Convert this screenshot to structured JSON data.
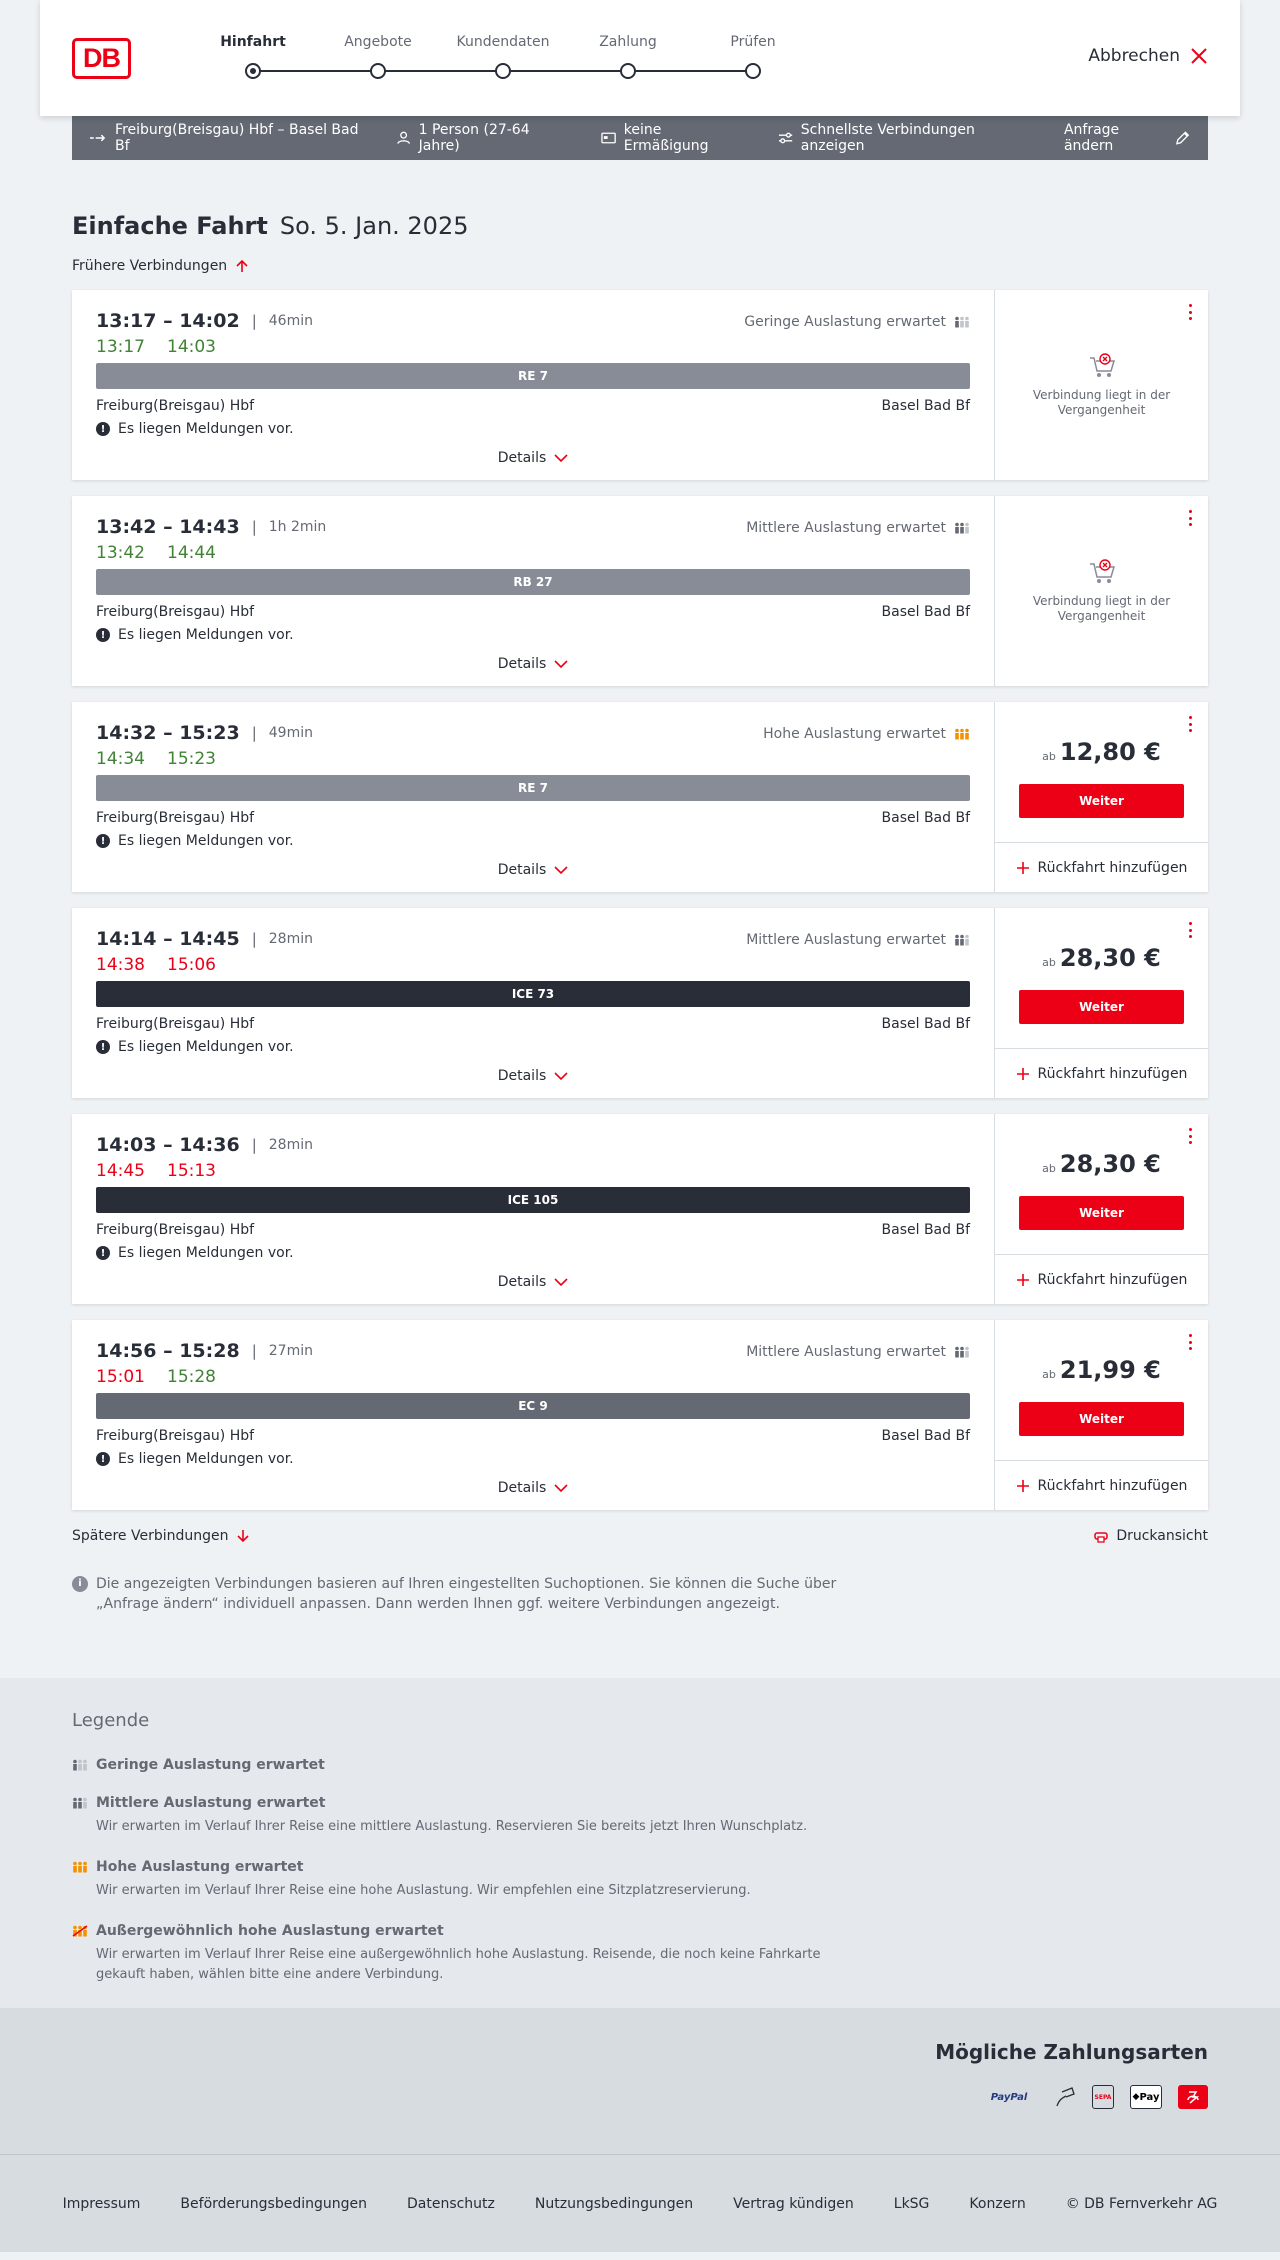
{
  "header": {
    "logo_text": "DB",
    "steps": [
      {
        "label": "Hinfahrt",
        "active": true
      },
      {
        "label": "Angebote",
        "active": false
      },
      {
        "label": "Kundendaten",
        "active": false
      },
      {
        "label": "Zahlung",
        "active": false
      },
      {
        "label": "Prüfen",
        "active": false
      }
    ],
    "cancel_label": "Abbrechen"
  },
  "infobar": {
    "route": "Freiburg(Breisgau) Hbf – Basel Bad Bf",
    "persons": "1 Person (27-64 Jahre)",
    "discount": "keine Ermäßigung",
    "fastest": "Schnellste Verbindungen anzeigen",
    "change": "Anfrage ändern"
  },
  "page": {
    "title": "Einfache Fahrt",
    "date": "So. 5. Jan. 2025",
    "earlier": "Frühere Verbindungen",
    "later": "Spätere Verbindungen",
    "print": "Druckansicht",
    "note": "Die angezeigten Verbindungen basieren auf Ihren eingestellten Suchoptionen. Sie können die Suche über „Anfrage ändern“ individuell anpassen. Dann werden Ihnen ggf. weitere Verbindungen angezeigt."
  },
  "colors": {
    "brand": "#ec0016",
    "green": "#408335",
    "regional": "#878c96",
    "ic": "#646973",
    "ice": "#282d37",
    "orange": "#f39200"
  },
  "connections": [
    {
      "time": "13:17 – 14:02",
      "duration": "46min",
      "occupancy": "Geringe Auslastung erwartet",
      "occ_level": 1,
      "real_dep": "13:17",
      "real_arr": "14:03",
      "dep_color": "green",
      "arr_color": "green",
      "train": "RE 7",
      "train_color": "#878c96",
      "from": "Freiburg(Breisgau) Hbf",
      "to": "Basel Bad Bf",
      "message": "Es liegen Meldungen vor.",
      "details": "Details",
      "past": true,
      "past_text": "Verbindung liegt in der Vergangenheit"
    },
    {
      "time": "13:42 – 14:43",
      "duration": "1h 2min",
      "occupancy": "Mittlere Auslastung erwartet",
      "occ_level": 2,
      "real_dep": "13:42",
      "real_arr": "14:44",
      "dep_color": "green",
      "arr_color": "green",
      "train": "RB 27",
      "train_color": "#878c96",
      "from": "Freiburg(Breisgau) Hbf",
      "to": "Basel Bad Bf",
      "message": "Es liegen Meldungen vor.",
      "details": "Details",
      "past": true,
      "past_text": "Verbindung liegt in der Vergangenheit"
    },
    {
      "time": "14:32 – 15:23",
      "duration": "49min",
      "occupancy": "Hohe Auslastung erwartet",
      "occ_level": 3,
      "real_dep": "14:34",
      "real_arr": "15:23",
      "dep_color": "green",
      "arr_color": "green",
      "train": "RE 7",
      "train_color": "#878c96",
      "from": "Freiburg(Breisgau) Hbf",
      "to": "Basel Bad Bf",
      "message": "Es liegen Meldungen vor.",
      "details": "Details",
      "past": false,
      "price_prefix": "ab",
      "price": "12,80 €",
      "button": "Weiter",
      "return": "Rückfahrt hinzufügen"
    },
    {
      "time": "14:14 – 14:45",
      "duration": "28min",
      "occupancy": "Mittlere Auslastung erwartet",
      "occ_level": 2,
      "real_dep": "14:38",
      "real_arr": "15:06",
      "dep_color": "red",
      "arr_color": "red",
      "train": "ICE 73",
      "train_color": "#282d37",
      "from": "Freiburg(Breisgau) Hbf",
      "to": "Basel Bad Bf",
      "message": "Es liegen Meldungen vor.",
      "details": "Details",
      "past": false,
      "price_prefix": "ab",
      "price": "28,30 €",
      "button": "Weiter",
      "return": "Rückfahrt hinzufügen"
    },
    {
      "time": "14:03 – 14:36",
      "duration": "28min",
      "occupancy": "",
      "occ_level": 0,
      "real_dep": "14:45",
      "real_arr": "15:13",
      "dep_color": "red",
      "arr_color": "red",
      "train": "ICE 105",
      "train_color": "#282d37",
      "from": "Freiburg(Breisgau) Hbf",
      "to": "Basel Bad Bf",
      "message": "Es liegen Meldungen vor.",
      "details": "Details",
      "past": false,
      "price_prefix": "ab",
      "price": "28,30 €",
      "button": "Weiter",
      "return": "Rückfahrt hinzufügen"
    },
    {
      "time": "14:56 – 15:28",
      "duration": "27min",
      "occupancy": "Mittlere Auslastung erwartet",
      "occ_level": 2,
      "real_dep": "15:01",
      "real_arr": "15:28",
      "dep_color": "red",
      "arr_color": "green",
      "train": "EC 9",
      "train_color": "#646973",
      "from": "Freiburg(Breisgau) Hbf",
      "to": "Basel Bad Bf",
      "message": "Es liegen Meldungen vor.",
      "details": "Details",
      "past": false,
      "price_prefix": "ab",
      "price": "21,99 €",
      "button": "Weiter",
      "return": "Rückfahrt hinzufügen"
    }
  ],
  "legend": {
    "title": "Legende",
    "items": [
      {
        "title": "Geringe Auslastung erwartet",
        "desc": "",
        "level": 1
      },
      {
        "title": "Mittlere Auslastung erwartet",
        "desc": "Wir erwarten im Verlauf Ihrer Reise eine mittlere Auslastung. Reservieren Sie bereits jetzt Ihren Wunschplatz.",
        "level": 2
      },
      {
        "title": "Hohe Auslastung erwartet",
        "desc": "Wir erwarten im Verlauf Ihrer Reise eine hohe Auslastung. Wir empfehlen eine Sitzplatzreservierung.",
        "level": 3
      },
      {
        "title": "Außergewöhnlich hohe Auslastung erwartet",
        "desc": "Wir erwarten im Verlauf Ihrer Reise eine außergewöhnlich hohe Auslastung. Reisende, die noch keine Fahrkarte gekauft haben, wählen bitte eine andere Verbindung.",
        "level": 4
      }
    ]
  },
  "payments": {
    "title": "Mögliche Zahlungsarten",
    "methods": [
      {
        "icon": "paypal-icon",
        "label": "PayPal"
      },
      {
        "icon": "creditcard-hand-icon",
        "label": ""
      },
      {
        "icon": "sepa-icon",
        "label": "SEPA"
      },
      {
        "icon": "applepay-icon",
        "label": "Pay"
      },
      {
        "icon": "db-bonus-icon",
        "label": ""
      }
    ]
  },
  "footer": {
    "links": [
      "Impressum",
      "Beförderungsbedingungen",
      "Datenschutz",
      "Nutzungsbedingungen",
      "Vertrag kündigen",
      "LkSG",
      "Konzern"
    ],
    "copyright": "© DB Fernverkehr AG"
  }
}
